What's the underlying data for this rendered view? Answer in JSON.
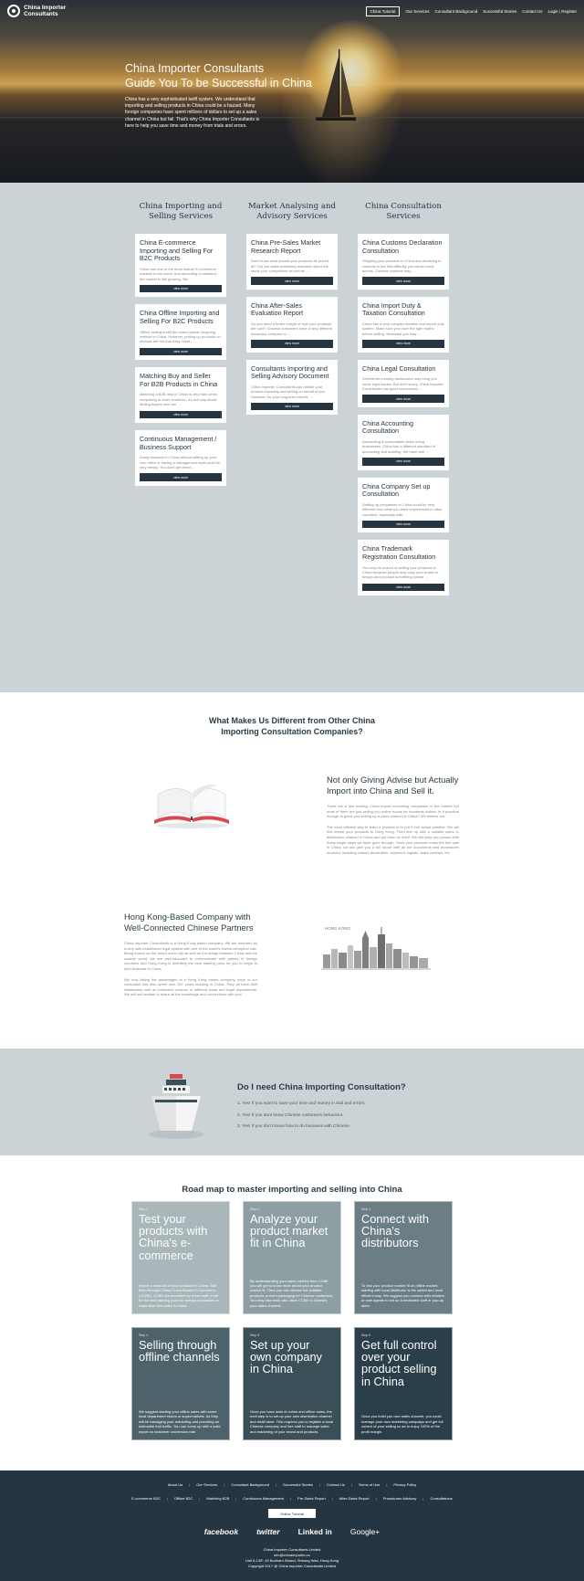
{
  "header": {
    "logo_text": "China Importer Consultants",
    "nav": [
      "China Tutorial",
      "Our Services",
      "Consultant Background",
      "Successful Stories",
      "Contact Us"
    ],
    "login": "Login",
    "register": "Register",
    "separator": "|"
  },
  "hero": {
    "title_line1": "China Importer Consultants",
    "title_line2": "Guide You To be Successful in China",
    "text": "China has a very sophisticated tariff system. We understand that importing and selling products in China could be a hazard. Many foreign companies have spent millions of dollars to set up a sales channel in China but fail. That's why China Importer Consultants is here to help you save time and money from trials and errors."
  },
  "services": {
    "button_label": "view more",
    "columns": [
      {
        "title": "China Importing and Selling Services",
        "cards": [
          {
            "title": "China E-commerce Importing and Selling For B2C Products",
            "text": "China has one of the most mature E-commerce markets in the world. And according to statistics, the market is still growing. We ..."
          },
          {
            "title": "China Offline Importing and Selling For B2C Products",
            "text": "Offline selling is still the most popular shopping method in China. However, putting up products on shelves are not that easy. Most ..."
          },
          {
            "title": "Matching Buy and Seller For B2B Products in China",
            "text": "Matching a B2B deal in China is very hard when comparing to other countries. It's not only about finding buyers who are ..."
          },
          {
            "title": "Continuous Management / Business Support",
            "text": "Doing business in China without setting up your own office or having a management staff could be very messy. You don't get direct ..."
          }
        ]
      },
      {
        "title": "Market Analysing and Advisory Services",
        "cards": [
          {
            "title": "China Pre-Sales Market Research Report",
            "text": "Don't know what should your products be priced at? Our pre-sales marketing research report will study your competitors as well as ..."
          },
          {
            "title": "China After-Sales Evaluation Report",
            "text": "Do you need a better insight of how your products are sold? Chinese customers have a very different behaviour compare to ..."
          },
          {
            "title": "Consultants Importing and Selling Advisory Document",
            "text": "China Importer Consultants can handle your product importing and selling on behalf of you. However, for your long-term benefit, ..."
          }
        ]
      },
      {
        "title": "China Consultation Services",
        "cards": [
          {
            "title": "China Customs Declaration Consultation",
            "text": "Shipping your products to China and declaring to customs is the first difficulty you would come across. Chinese customs may ..."
          },
          {
            "title": "China Import Duty & Taxation Consultation",
            "text": "China has a very complex taxation and import duty system. Make sure you have the right moths before selling, otherwise you may ..."
          },
          {
            "title": "China Legal Consultation",
            "text": "Sometimes running businesses may bring you some legal issues. But don't worry, China Importer Consultants has good connections ..."
          },
          {
            "title": "China Accounting Consultation",
            "text": "Accounting is unavoidable when doing businesses. China has a different standard of accounting and auditing. We have well ..."
          },
          {
            "title": "China Company Set up Consultation",
            "text": "Setting up companies in China could be very different from what you have experienced in other countries, especially with ..."
          },
          {
            "title": "China Trademark Registration Consultation",
            "text": "You may be scared of selling your products to China because people may copy your brand or design and produce something similar ..."
          }
        ]
      }
    ]
  },
  "different": {
    "title": "What Makes Us Different from Other China Importing Consultation Companies?",
    "block1_title": "Not only Giving Advise but Actually Import into China and Sell it.",
    "block1_p1": "There are a few existing China import consulting companies in the market but most of them are just selling you online books for hundreds dollars. Is it practical enough to guide you setting up a sales channel in China? We believe not.",
    "block1_p2": "The most efficient way to learn a process is to put it into actual practice. We will first import your products to Hong Kong. Then line up with a suitable sales or distribution channel in China and put them on shelf. We will keep you posted with every single steps we have gone through. Once your products make the first sale in China, we will give you a full report with all the documents and procedures involved, including custom declaration, shipment, logistic, sales contract, etc.",
    "block2_title": "Hong Kong-Based Company with Well-Connected Chinese Partners",
    "block2_p1": "China Importer Consultants is a Hong Kong based company. We are bounded by a very well-established legal system with one of the world's lowest corruption rate. Being known as the Asia's world city as well as the bridge between China and the outside world, we are well-educated to communicate with parties in foreign countries and Hong Kong is definitely the best starting point for you to begin to your business in China.",
    "block2_p2": "Not only taking the advantages of a Hong Kong based company, each of our consultant has also spent over 30+ years working in China. They all have built relationship with an extensive network in different trade and legal departments. We will not hesitate to share all the knowledge and connections with you!",
    "city_label": "HONG KONG"
  },
  "need": {
    "title": "Do I need China Importing Consultation?",
    "items": [
      "1. Yes! If you want to save your time and money in trial and errors.",
      "2. Yes! If you dont know Chinese customers behaviour.",
      "3. Yes! If you don't know how to do business with Chinese."
    ]
  },
  "roadmap": {
    "title": "Road map to master importing and selling into China",
    "steps": [
      {
        "label": "Step 1",
        "title": "Test your products with China's e-commerce",
        "text": "Import a small lot of your products in China. Sell them through China Cross-Border E-Commerce (CCBE). CCBE are benefited by a low tariff. It will be the best starting point for foreign companies to make their first sales in China.",
        "color": "#a9b7ba"
      },
      {
        "label": "Step 2",
        "title": "Analyze your product market fit in China",
        "text": "By understanding your sales metrics from CCBE, you will get to know more about your product market fit. Then you can choose the suitable products or even packaging for Chinese customers. You may also work with other CCBE to diversify your sales channel.",
        "color": "#8e9fa4"
      },
      {
        "label": "Step 3",
        "title": "Connect with China's distributors",
        "text": "To test your product market fit on offline market, starting with local distributor is the safest and most efficient way. We suggest you connect with retailers or sale agents to set up a dedicated staff or pop-up store.",
        "color": "#6b7e85"
      },
      {
        "label": "Step 4",
        "title": "Selling through offline channels",
        "text": "We suggest starting your offline sales with some local department stores or supermarkets. As they will be managing your marketing and providing an estimable foot traffic. You can come up with a solid report on customer conversion rate.",
        "color": "#4d626a"
      },
      {
        "label": "Step 5",
        "title": "Set up your own company in China",
        "text": "Once you have data of online and offline sales, the next step is to set up your own distribution channel and retail store. This requires you to register a local Chinese company and hire staff to manage sales and marketing of your brand and products.",
        "color": "#3a4f58"
      },
      {
        "label": "Step 6",
        "title": "Get full control over your product selling in China",
        "text": "Once you build you own sales channel, you could manage your own marketing campaign and get full control of your selling so as to enjoy 100% of the profit margin.",
        "color": "#2a3f49"
      }
    ]
  },
  "footer": {
    "row1": [
      "About Us",
      "Our Services",
      "Consultant Background",
      "Successful Stories",
      "Contact Us",
      "Terms of Use",
      "Privacy Policy"
    ],
    "row2": [
      "E-commerce B2C",
      "Offline B2C",
      "Matching B2B",
      "Continuous Management",
      "Pre-Sales Report",
      "After-Sales Report",
      "Procedures Advisory",
      "Consultations"
    ],
    "tutorial": "Online Tutorial",
    "social": [
      "facebook",
      "twitter",
      "Linked in",
      "Google+"
    ],
    "company": "China Importer Consultants Limited",
    "email": "info@chinaimporter.cc",
    "address": "Unit 6,13/F, 45 Bonham Strand, Sheung Wan, Hong Kong",
    "copyright": "Copyright 2017 @ China Importer Consultants Limited"
  }
}
